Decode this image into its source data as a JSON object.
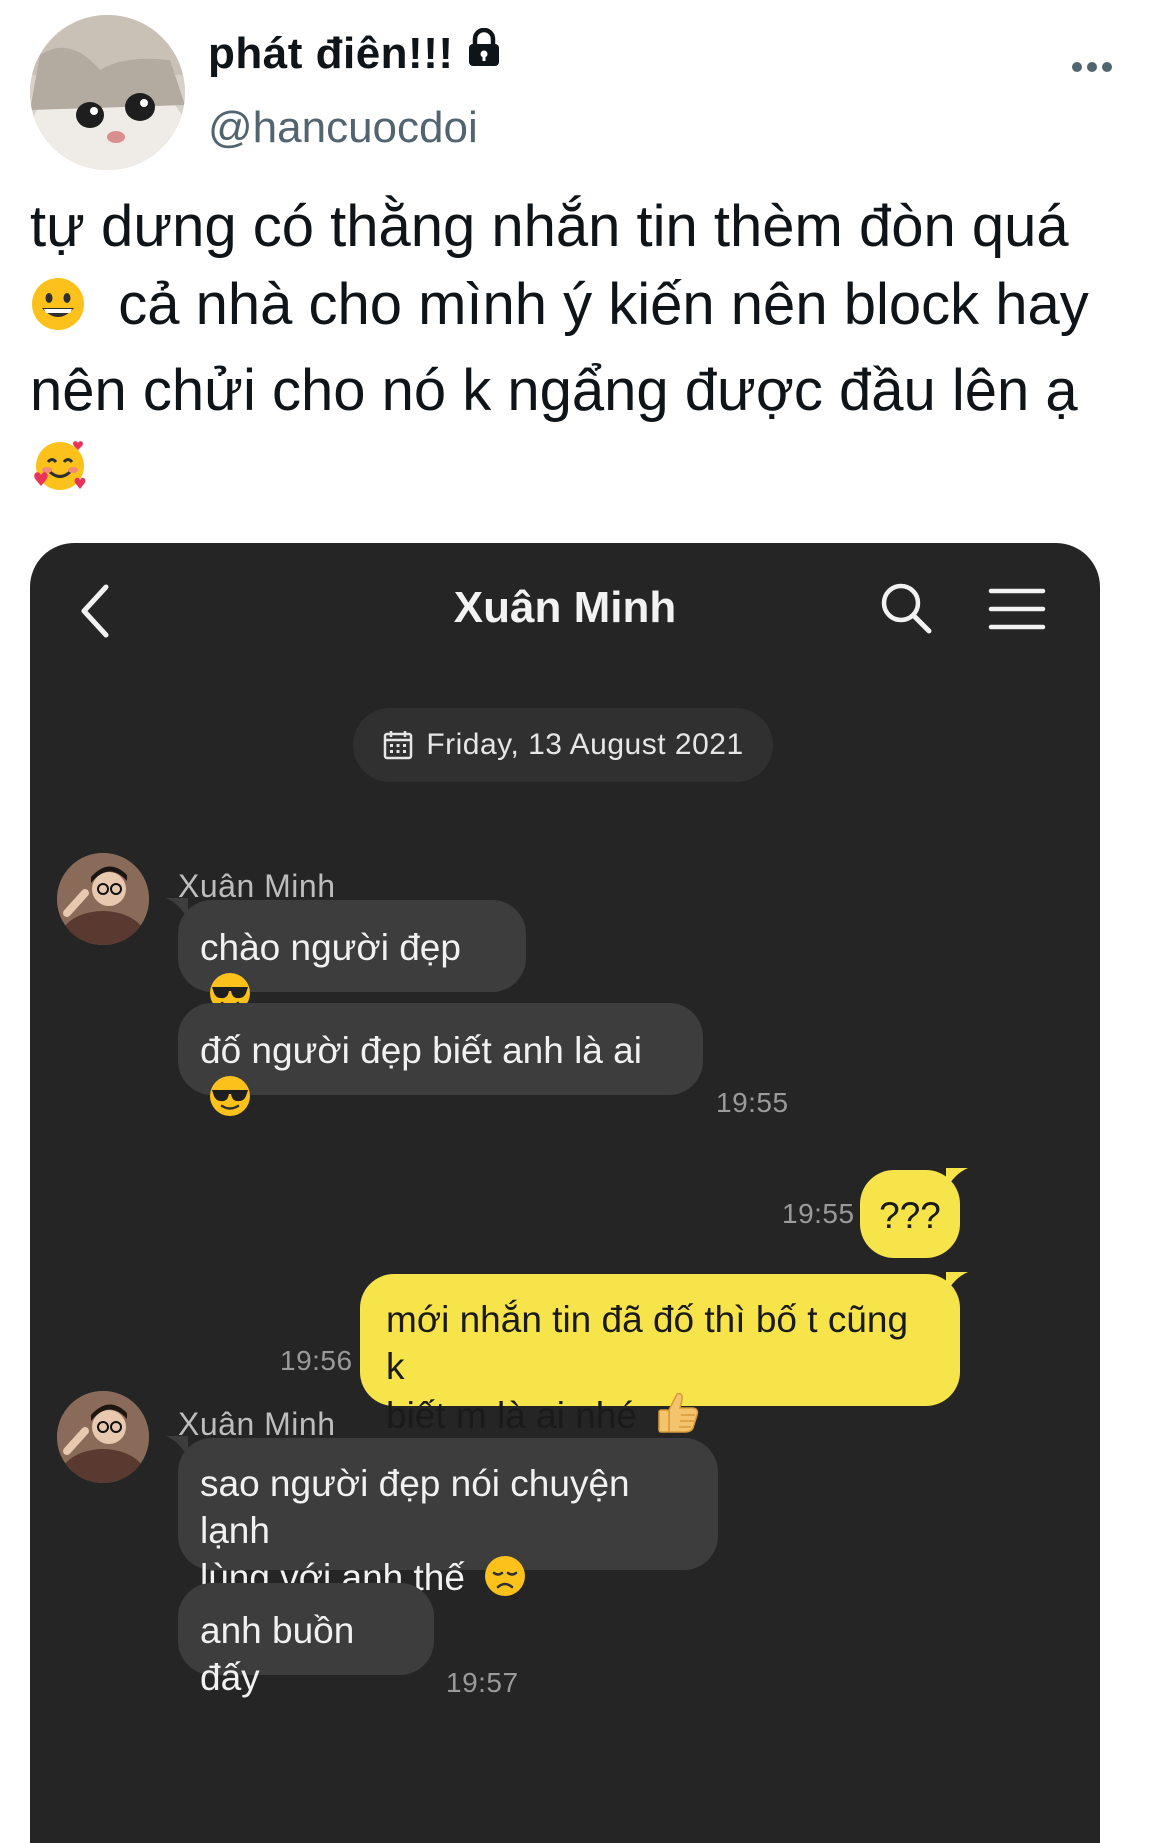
{
  "tweet": {
    "display_name": "phát điên!!!",
    "handle": "@hancuocdoi",
    "text_line1": "tự dưng có thằng nhắn tin thèm đòn quá",
    "text_line2": "cả nhà cho mình ý kiến nên block hay",
    "text_line3": "nên chửi cho nó k ngẩng được đầu lên ạ",
    "icons": [
      "lock-icon",
      "more-icon",
      "grinning-face-emoji",
      "smiling-face-with-hearts-emoji"
    ]
  },
  "chat": {
    "title": "Xuân Minh",
    "date": "Friday, 13 August 2021",
    "icons": [
      "back-chevron-icon",
      "search-icon",
      "menu-icon",
      "calendar-icon"
    ],
    "colors": {
      "background": "#252525",
      "incoming_bubble": "#3d3d3d",
      "outgoing_bubble": "#f7e34a"
    },
    "groups": [
      {
        "sender": "Xuân Minh",
        "messages": [
          {
            "text": "chào người đẹp",
            "emoji": "sunglasses-emoji"
          },
          {
            "text": "đố người đẹp biết anh là ai",
            "emoji": "sunglasses-emoji"
          }
        ],
        "time": "19:55"
      },
      {
        "sender": "me",
        "messages": [
          {
            "text": "???"
          }
        ],
        "time": "19:55"
      },
      {
        "sender": "me",
        "messages": [
          {
            "text_line1": "mới nhắn tin đã đố thì bố t cũng k",
            "text_line2": "biết m là ai nhé",
            "emoji": "thumbs-up-emoji"
          }
        ],
        "time": "19:56"
      },
      {
        "sender": "Xuân Minh",
        "messages": [
          {
            "text_line1": "sao người đẹp nói chuyện lạnh",
            "text_line2": "lùng với anh thế",
            "emoji": "disappointed-face-emoji"
          },
          {
            "text": "anh buồn đấy"
          }
        ],
        "time": "19:57"
      }
    ]
  }
}
